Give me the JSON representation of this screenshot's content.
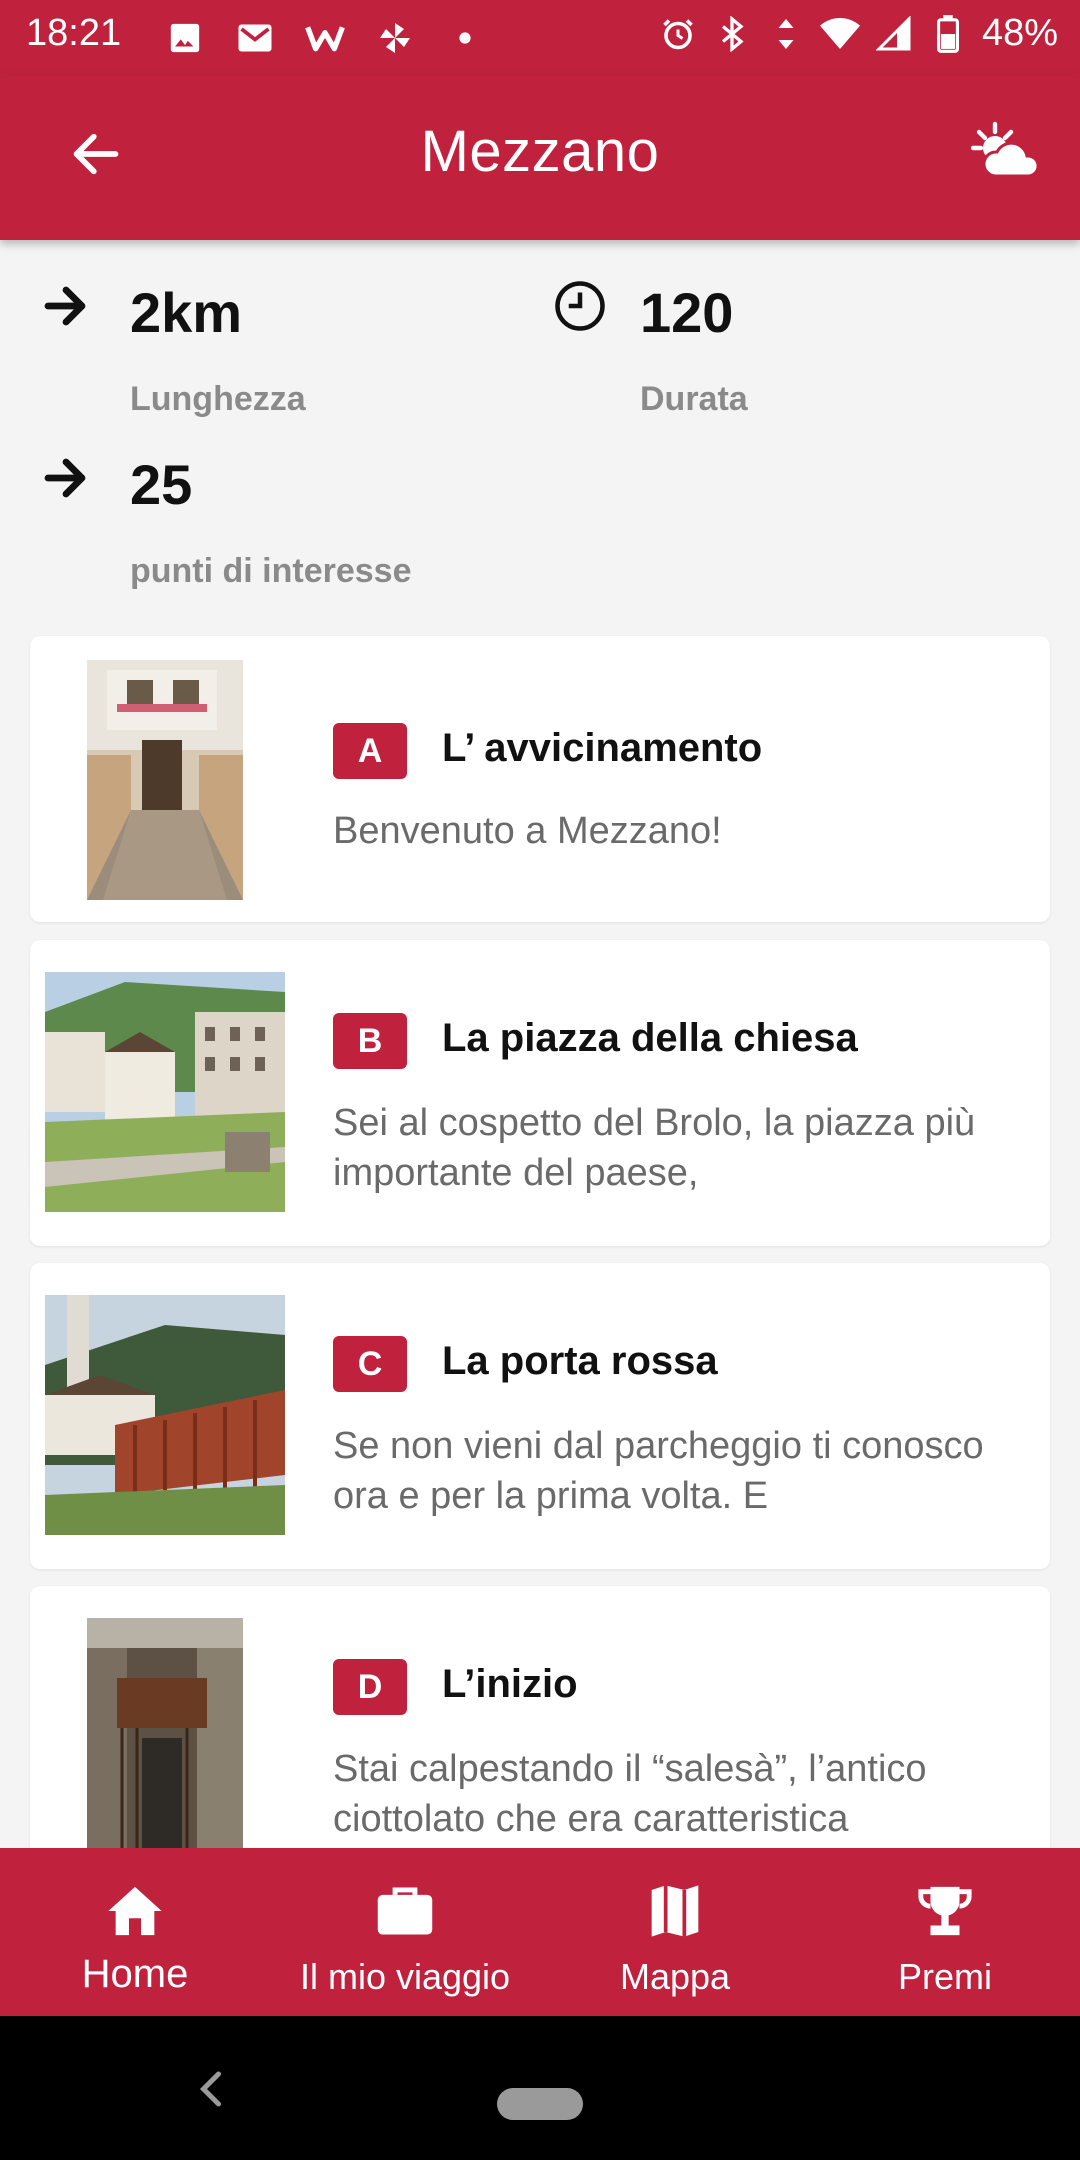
{
  "status_bar": {
    "time": "18:21",
    "battery": "48%",
    "icons_left": [
      "image-icon",
      "gmail-icon",
      "w-app-icon",
      "pinwheel-icon",
      "dot-icon"
    ],
    "icons_right": [
      "alarm-icon",
      "bluetooth-icon",
      "data-arrows-icon",
      "wifi-icon",
      "signal-icon",
      "battery-icon"
    ]
  },
  "app_bar": {
    "title": "Mezzano",
    "back_icon": "arrow-left-icon",
    "weather_icon": "weather-cloud-sun-icon"
  },
  "stats": {
    "length_value": "2km",
    "length_label": "Lunghezza",
    "duration_value": "120",
    "duration_label": "Durata",
    "poi_value": "25",
    "poi_label": "punti di interesse"
  },
  "stops": [
    {
      "letter": "A",
      "title": "L’ avvicinamento",
      "description": "Benvenuto a Mezzano!"
    },
    {
      "letter": "B",
      "title": "La piazza della chiesa",
      "description": "Sei al cospetto del Brolo, la piazza più importante del paese,"
    },
    {
      "letter": "C",
      "title": "La porta rossa",
      "description": "Se non vieni dal parcheggio ti conosco ora e per la prima volta. E"
    },
    {
      "letter": "D",
      "title": "L’inizio",
      "description": "Stai calpestando il “salesà”, l’antico ciottolato che era caratteristica"
    }
  ],
  "bottom_nav": [
    {
      "label": "Home",
      "icon": "home-icon",
      "active": true
    },
    {
      "label": "Il mio viaggio",
      "icon": "briefcase-icon",
      "active": false
    },
    {
      "label": "Mappa",
      "icon": "map-icon",
      "active": false
    },
    {
      "label": "Premi",
      "icon": "trophy-icon",
      "active": false
    }
  ],
  "colors": {
    "primary": "#c0223d",
    "background": "#f4f4f4",
    "card": "#ffffff",
    "label_gray": "#8a8a8a",
    "desc_gray": "#6a6a6a"
  }
}
